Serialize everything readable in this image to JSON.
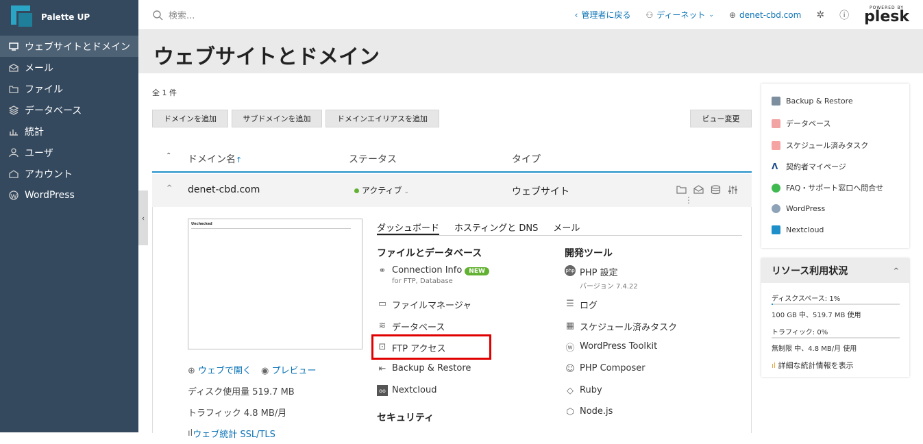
{
  "app": {
    "brand": "Palette UP"
  },
  "sidebar": {
    "items": [
      {
        "label": "ウェブサイトとドメイン",
        "icon": "monitor-icon"
      },
      {
        "label": "メール",
        "icon": "mail-icon"
      },
      {
        "label": "ファイル",
        "icon": "folder-icon"
      },
      {
        "label": "データベース",
        "icon": "database-icon"
      },
      {
        "label": "統計",
        "icon": "stats-icon"
      },
      {
        "label": "ユーザ",
        "icon": "user-icon"
      },
      {
        "label": "アカウント",
        "icon": "account-icon"
      },
      {
        "label": "WordPress",
        "icon": "wordpress-icon"
      }
    ]
  },
  "topbar": {
    "search_placeholder": "検索...",
    "back_admin": "管理者に戻る",
    "user": "ディーネット",
    "domain": "denet-cbd.com",
    "powered_by": "POWERED BY",
    "plesk": "plesk"
  },
  "page": {
    "title": "ウェブサイトとドメイン",
    "count": "全 1 件"
  },
  "buttons": {
    "add_domain": "ドメインを追加",
    "add_subdomain": "サブドメインを追加",
    "add_alias": "ドメインエイリアスを追加",
    "change_view": "ビュー変更"
  },
  "table": {
    "col_domain": "ドメイン名",
    "sort_arrow": "↑",
    "col_status": "ステータス",
    "col_type": "タイプ",
    "row": {
      "domain": "denet-cbd.com",
      "status": "アクティブ",
      "type": "ウェブサイト"
    }
  },
  "detail": {
    "preview_title": "Unchecked",
    "open_web": "ウェブで開く",
    "preview": "プレビュー",
    "disk_usage": "ディスク使用量 519.7 MB",
    "traffic": "トラフィック 4.8 MB/月",
    "web_stats": "ウェブ統計 SSL/TLS",
    "tabs": [
      "ダッシュボード",
      "ホスティングと DNS",
      "メール"
    ],
    "sec_files": "ファイルとデータベース",
    "sec_dev": "開発ツール",
    "sec_security": "セキュリティ",
    "files_tools": {
      "connection": "Connection Info",
      "new_badge": "NEW",
      "connection_sub": "for FTP, Database",
      "file_manager": "ファイルマネージャ",
      "database": "データベース",
      "ftp": "FTP アクセス",
      "backup": "Backup & Restore",
      "nextcloud": "Nextcloud"
    },
    "dev_tools": {
      "php": "PHP 設定",
      "php_sub": "バージョン 7.4.22",
      "log": "ログ",
      "scheduled": "スケジュール済みタスク",
      "wp_toolkit": "WordPress Toolkit",
      "composer": "PHP Composer",
      "ruby": "Ruby",
      "node": "Node.js"
    }
  },
  "right_panel": {
    "items": [
      "Backup & Restore",
      "データベース",
      "スケジュール済みタスク",
      "契約者マイページ",
      "FAQ・サポート窓口へ問合せ",
      "WordPress",
      "Nextcloud"
    ]
  },
  "resources": {
    "title": "リソース利用状況",
    "disk_label": "ディスクスペース: 1%",
    "disk_detail": "100 GB 中、519.7 MB 使用",
    "disk_fraction": 0.01,
    "traffic_label": "トラフィック: 0%",
    "traffic_detail": "無制限 中、4.8 MB/月 使用",
    "traffic_fraction": 0.0,
    "stats_link": "詳細な統計情報を表示"
  },
  "colors": {
    "sidebar": "#34495e",
    "accent": "#0b73b6",
    "active_green": "#63b132",
    "highlight_red": "#e00000"
  }
}
